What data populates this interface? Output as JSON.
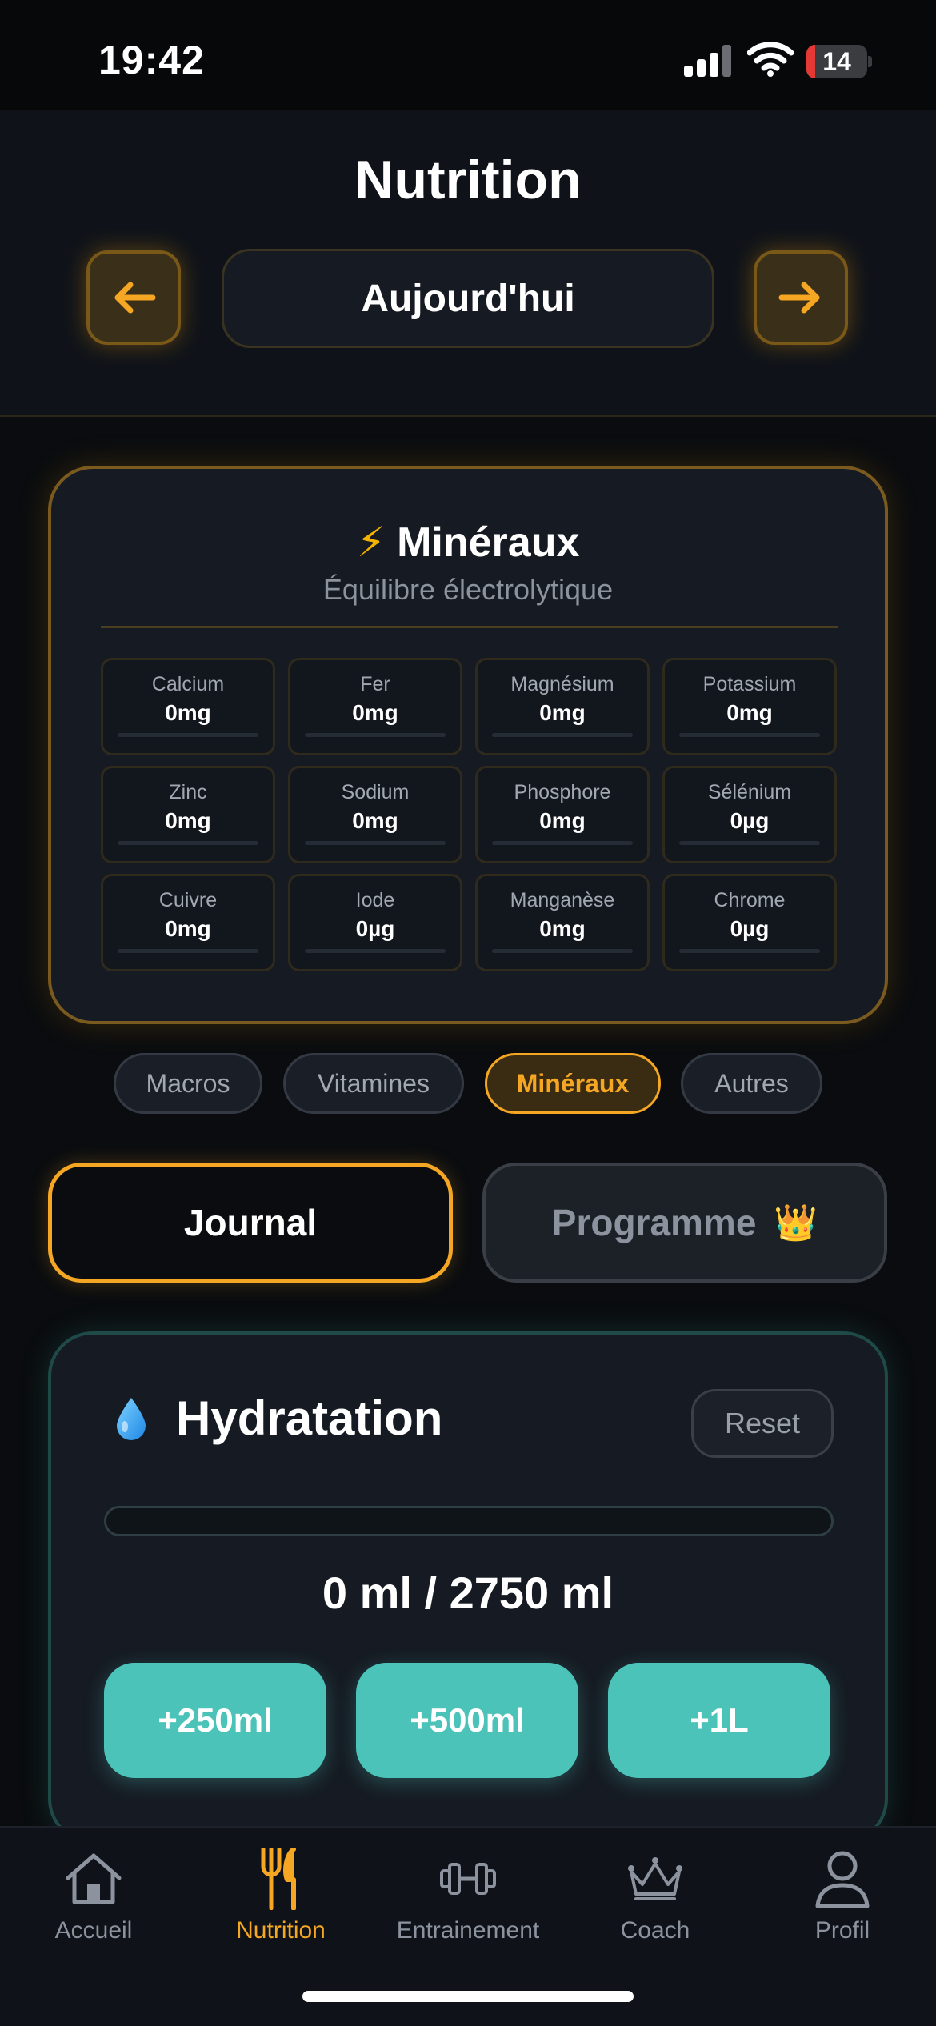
{
  "status_bar": {
    "time": "19:42",
    "battery": "14",
    "battery_level": 0.14
  },
  "header": {
    "title": "Nutrition",
    "date_label": "Aujourd'hui",
    "prev_icon": "arrow-left-icon",
    "next_icon": "arrow-right-icon"
  },
  "minerals": {
    "icon": "⚡",
    "title": "Minéraux",
    "subtitle": "Équilibre électrolytique",
    "items": [
      {
        "name": "Calcium",
        "value": "0mg"
      },
      {
        "name": "Fer",
        "value": "0mg"
      },
      {
        "name": "Magnésium",
        "value": "0mg"
      },
      {
        "name": "Potassium",
        "value": "0mg"
      },
      {
        "name": "Zinc",
        "value": "0mg"
      },
      {
        "name": "Sodium",
        "value": "0mg"
      },
      {
        "name": "Phosphore",
        "value": "0mg"
      },
      {
        "name": "Sélénium",
        "value": "0µg"
      },
      {
        "name": "Cuivre",
        "value": "0mg"
      },
      {
        "name": "Iode",
        "value": "0µg"
      },
      {
        "name": "Manganèse",
        "value": "0mg"
      },
      {
        "name": "Chrome",
        "value": "0µg"
      }
    ]
  },
  "segments": [
    {
      "label": "Macros",
      "active": false
    },
    {
      "label": "Vitamines",
      "active": false
    },
    {
      "label": "Minéraux",
      "active": true
    },
    {
      "label": "Autres",
      "active": false
    }
  ],
  "modes": {
    "journal": "Journal",
    "programme": "Programme",
    "programme_icon": "👑"
  },
  "hydration": {
    "icon": "water-drop-icon",
    "title": "Hydratation",
    "reset_label": "Reset",
    "amount": "0 ml / 2750 ml",
    "progress": 0,
    "buttons": [
      "+250ml",
      "+500ml",
      "+1L"
    ]
  },
  "tab_bar": {
    "items": [
      {
        "label": "Accueil",
        "icon": "home-icon",
        "active": false
      },
      {
        "label": "Nutrition",
        "icon": "fork-knife-icon",
        "active": true
      },
      {
        "label": "Entrainement",
        "icon": "dumbbell-icon",
        "active": false
      },
      {
        "label": "Coach",
        "icon": "crown-icon",
        "active": false
      },
      {
        "label": "Profil",
        "icon": "person-icon",
        "active": false
      }
    ]
  },
  "colors": {
    "accent": "#f5a623",
    "teal": "#4cc3b8",
    "background": "#0a0c0f",
    "card": "#161b23"
  }
}
